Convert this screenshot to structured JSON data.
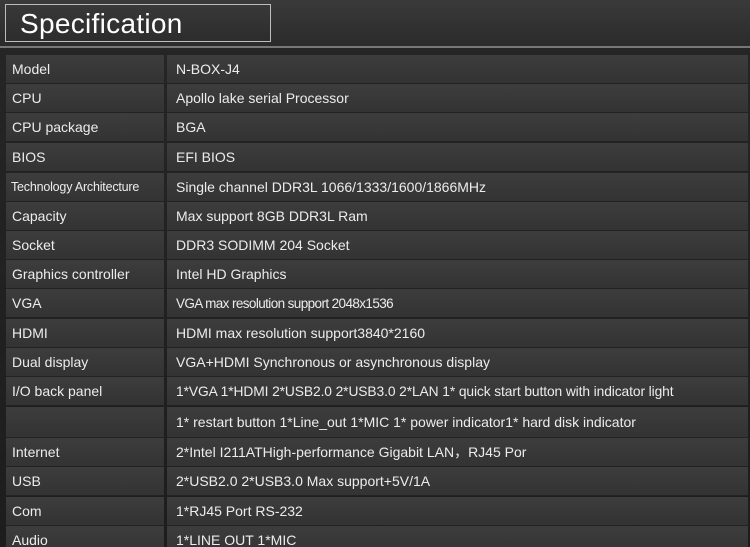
{
  "header": {
    "title": "Specification"
  },
  "specs": [
    {
      "label": "Model",
      "value": "N-BOX-J4"
    },
    {
      "label": "CPU",
      "value": "Apollo lake serial Processor"
    },
    {
      "label": "CPU package",
      "value": "BGA"
    },
    {
      "label": "BIOS",
      "value": "EFI BIOS"
    },
    {
      "label": "Technology Architecture",
      "value": "Single channel DDR3L 1066/1333/1600/1866MHz"
    },
    {
      "label": "Capacity",
      "value": "Max support 8GB DDR3L Ram"
    },
    {
      "label": "Socket",
      "value": "DDR3 SODIMM 204 Socket"
    },
    {
      "label": "Graphics controller",
      "value": "Intel HD Graphics"
    },
    {
      "label": "VGA",
      "value": "VGA max resolution support 2048x1536"
    },
    {
      "label": "HDMI",
      "value": "HDMI max resolution support3840*2160"
    },
    {
      "label": "Dual display",
      "value": "VGA+HDMI Synchronous or asynchronous display"
    },
    {
      "label": "I/O back panel",
      "value": "1*VGA 1*HDMI 2*USB2.0 2*USB3.0 2*LAN 1* quick start button with indicator light"
    },
    {
      "label": "",
      "value": "1* restart button 1*Line_out 1*MIC 1* power indicator1* hard disk indicator"
    },
    {
      "label": "Internet",
      "value": "2*Intel I211ATHigh-performance Gigabit LAN，RJ45 Por"
    },
    {
      "label": "USB",
      "value": "2*USB2.0 2*USB3.0 Max support+5V/1A"
    },
    {
      "label": "Com",
      "value": "1*RJ45 Port RS-232"
    },
    {
      "label": "Audio",
      "value": "1*LINE OUT 1*MIC"
    }
  ]
}
